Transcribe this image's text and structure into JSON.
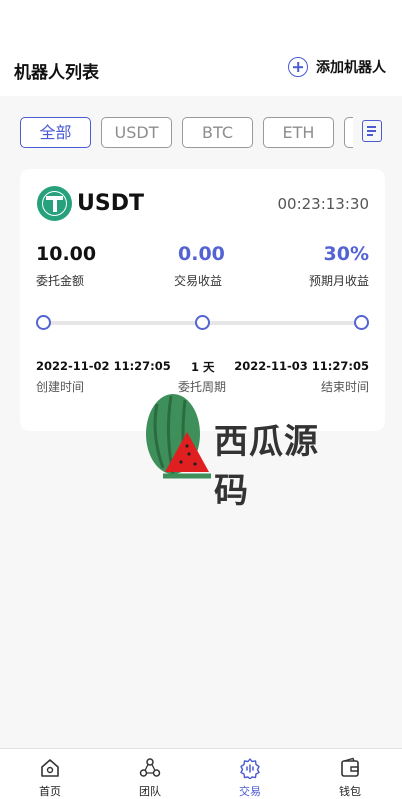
{
  "header": {
    "title": "机器人列表",
    "add_label": "添加机器人"
  },
  "filters": [
    {
      "label": "全部",
      "active": true
    },
    {
      "label": "USDT",
      "active": false
    },
    {
      "label": "BTC",
      "active": false
    },
    {
      "label": "ETH",
      "active": false
    }
  ],
  "robot_card": {
    "coin": "USDT",
    "timer": "00:23:13:30",
    "stats": [
      {
        "value": "10.00",
        "label": "委托金额"
      },
      {
        "value": "0.00",
        "label": "交易收益"
      },
      {
        "value": "30%",
        "label": "预期月收益"
      }
    ],
    "start_date": "2022-11-02 11:27:05",
    "start_label": "创建时间",
    "period": "1 天",
    "period_label": "委托周期",
    "end_date": "2022-11-03 11:27:05",
    "end_label": "结束时间"
  },
  "watermark": {
    "text": "西瓜源码"
  },
  "bottom_nav": [
    {
      "label": "首页",
      "icon": "home-icon",
      "active": false
    },
    {
      "label": "团队",
      "icon": "team-icon",
      "active": false
    },
    {
      "label": "交易",
      "icon": "trade-icon",
      "active": true
    },
    {
      "label": "钱包",
      "icon": "wallet-icon",
      "active": false
    }
  ],
  "colors": {
    "accent": "#4a5bd4",
    "tether_green": "#26a17b",
    "background": "#f7f7f7"
  }
}
